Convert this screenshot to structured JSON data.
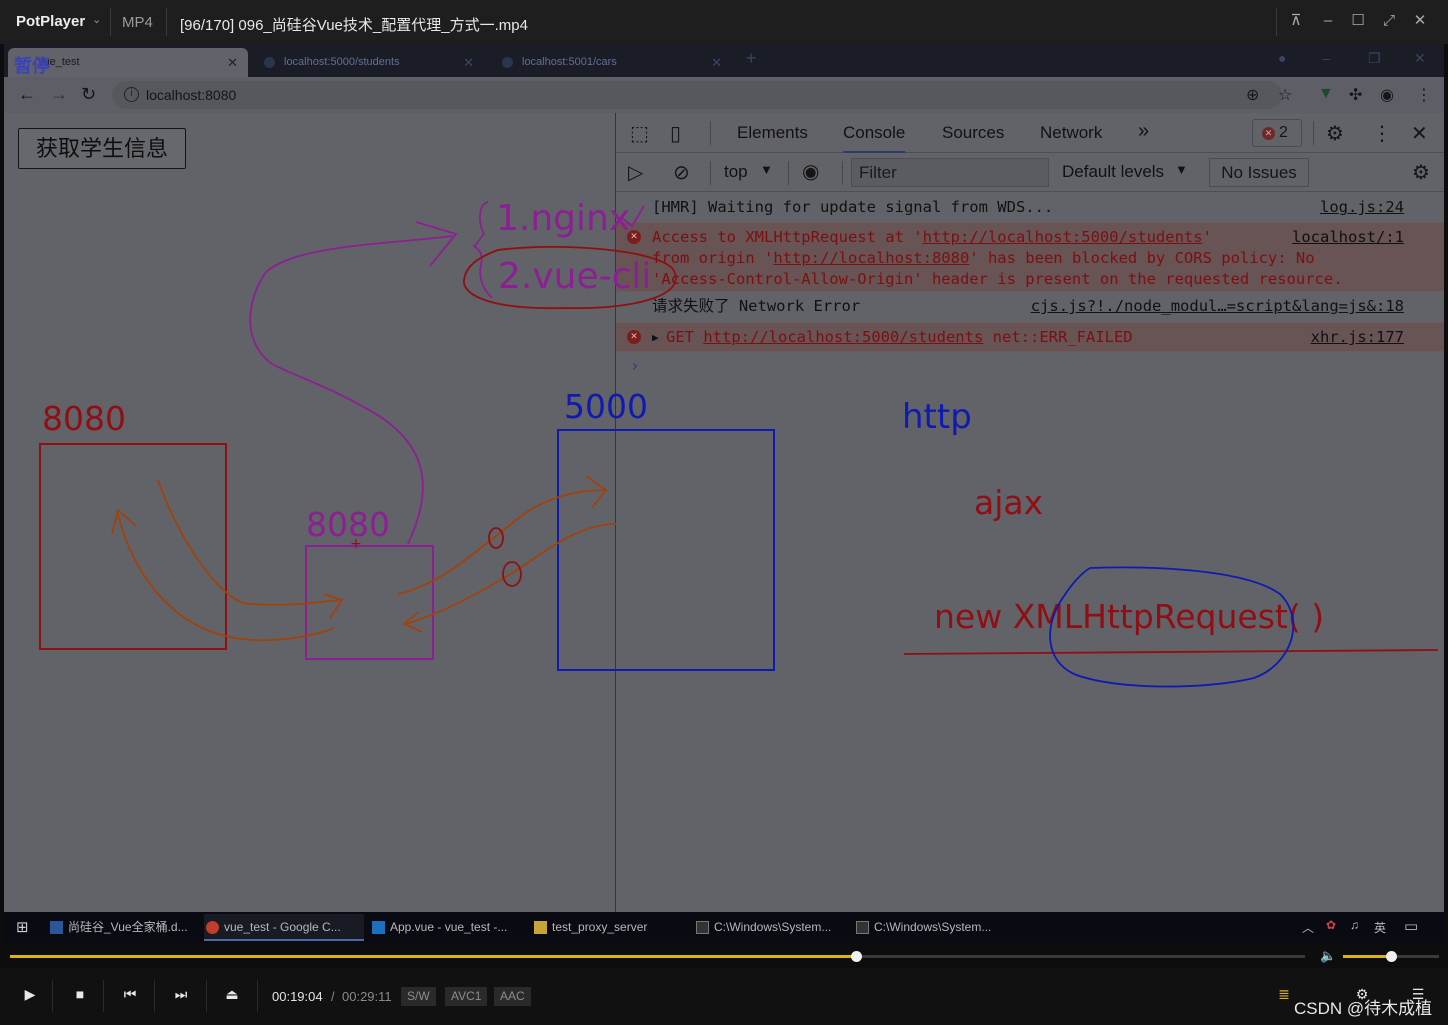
{
  "player": {
    "app_name": "PotPlayer",
    "format": "MP4",
    "file_title": "[96/170] 096_尚硅谷Vue技术_配置代理_方式一.mp4",
    "current_time": "00:19:04",
    "time_separator": "/",
    "total_time": "00:29:11",
    "chips": [
      "S/W",
      "AVC1",
      "AAC"
    ],
    "progress_fraction": 0.653,
    "volume_fraction": 0.5,
    "watermark": "CSDN @待木成植",
    "accent": "#d7b21b"
  },
  "browser": {
    "paused_overlay": "暂停",
    "tabs": [
      {
        "label": "vue_test",
        "active": true
      },
      {
        "label": "localhost:5000/students",
        "active": false
      },
      {
        "label": "localhost:5001/cars",
        "active": false
      }
    ],
    "new_tab": "+",
    "url": "localhost:8080"
  },
  "page": {
    "button_label": "获取学生信息"
  },
  "devtools": {
    "tabs": [
      "Elements",
      "Console",
      "Sources",
      "Network"
    ],
    "more": "»",
    "error_count": "2",
    "context": "top",
    "filter_placeholder": "Filter",
    "levels": "Default levels",
    "issues": "No Issues",
    "console": {
      "hmr": {
        "text": "[HMR] Waiting for update signal from WDS...",
        "source": "log.js:24"
      },
      "cors": {
        "line1_a": "Access to XMLHttpRequest at '",
        "line1_url": "http://localhost:5000/students",
        "line1_b": "'",
        "line2_a": "from origin '",
        "line2_url": "http://localhost:8080",
        "line2_b": "' has been blocked by CORS policy: No",
        "line3": "'Access-Control-Allow-Origin' header is present on the requested resource.",
        "source": "localhost/:1"
      },
      "log": {
        "text": "请求失败了 Network Error",
        "source": "cjs.js?!./node_modul…=script&lang=js&:18"
      },
      "get": {
        "method": "GET",
        "url": "http://localhost:5000/students",
        "status": "net::ERR_FAILED",
        "source": "xhr.js:177"
      },
      "prompt": "›"
    }
  },
  "annotations": {
    "nginx": "1.nginx",
    "vuecli": "2.vue-cli",
    "box_left_label": "8080",
    "box_mid_label": "8080",
    "box_server_label": "5000",
    "http": "http",
    "ajax": "ajax",
    "xhr": "new XMLHttpRequest( )",
    "colors": {
      "red": "#8f0f14",
      "purple": "#8c1f93",
      "blue": "#0f1ab0",
      "orange": "#a0420c"
    }
  },
  "taskbar": {
    "items": [
      {
        "label": "尚硅谷_Vue全家桶.d...",
        "icon": "word-icon"
      },
      {
        "label": "vue_test - Google C...",
        "icon": "chrome-icon"
      },
      {
        "label": "App.vue - vue_test -...",
        "icon": "vscode-icon"
      },
      {
        "label": "test_proxy_server",
        "icon": "folder-icon"
      },
      {
        "label": "C:\\Windows\\System...",
        "icon": "cmd-icon"
      },
      {
        "label": "C:\\Windows\\System...",
        "icon": "cmd-icon"
      }
    ],
    "ime": "英"
  }
}
